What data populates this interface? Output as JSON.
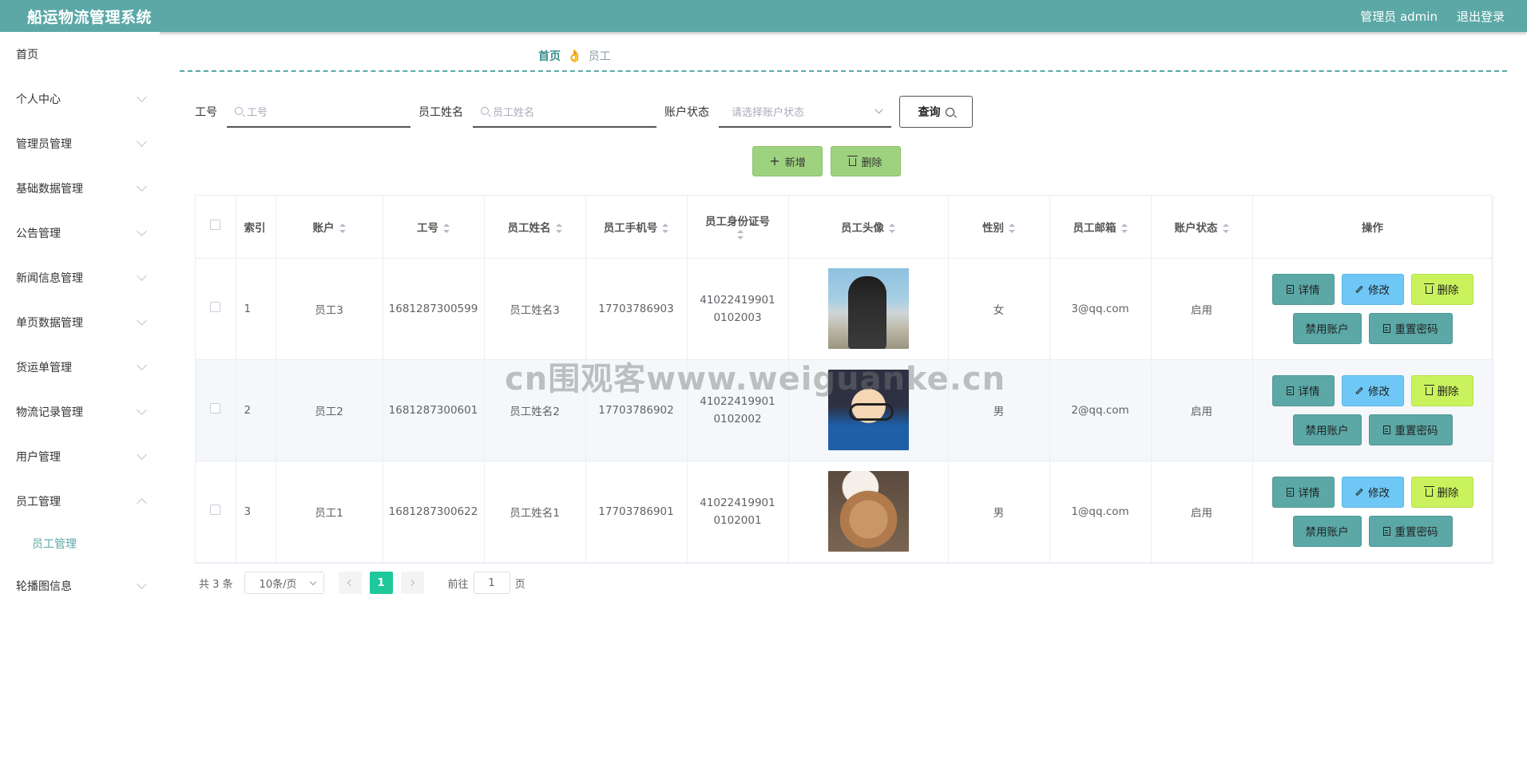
{
  "header": {
    "title": "船运物流管理系统",
    "user": "管理员 admin",
    "logout": "退出登录"
  },
  "sidebar": {
    "items": [
      {
        "label": "首页"
      },
      {
        "label": "个人中心"
      },
      {
        "label": "管理员管理"
      },
      {
        "label": "基础数据管理"
      },
      {
        "label": "公告管理"
      },
      {
        "label": "新闻信息管理"
      },
      {
        "label": "单页数据管理"
      },
      {
        "label": "货运单管理"
      },
      {
        "label": "物流记录管理"
      },
      {
        "label": "用户管理"
      },
      {
        "label": "员工管理"
      },
      {
        "label": "轮播图信息"
      }
    ],
    "sub_active": "员工管理"
  },
  "breadcrumb": {
    "home": "首页",
    "sep": "👌",
    "current": "员工"
  },
  "search": {
    "field1_label": "工号",
    "field1_placeholder": "工号",
    "field2_label": "员工姓名",
    "field2_placeholder": "员工姓名",
    "field3_label": "账户状态",
    "field3_placeholder": "请选择账户状态",
    "query_label": "查询"
  },
  "actions": {
    "add": "新增",
    "delete": "删除"
  },
  "table": {
    "headers": [
      "索引",
      "账户",
      "工号",
      "员工姓名",
      "员工手机号",
      "员工身份证号",
      "员工头像",
      "性别",
      "员工邮箱",
      "账户状态",
      "操作"
    ],
    "rows": [
      {
        "index": "1",
        "account": "员工3",
        "no": "1681287300599",
        "name": "员工姓名3",
        "phone": "17703786903",
        "id_card": "410224199010102003",
        "gender": "女",
        "email": "3@qq.com",
        "status": "启用"
      },
      {
        "index": "2",
        "account": "员工2",
        "no": "1681287300601",
        "name": "员工姓名2",
        "phone": "17703786902",
        "id_card": "410224199010102002",
        "gender": "男",
        "email": "2@qq.com",
        "status": "启用"
      },
      {
        "index": "3",
        "account": "员工1",
        "no": "1681287300622",
        "name": "员工姓名1",
        "phone": "17703786901",
        "id_card": "410224199010102001",
        "gender": "男",
        "email": "1@qq.com",
        "status": "启用"
      }
    ],
    "ops": {
      "detail": "详情",
      "edit": "修改",
      "delete": "删除",
      "ban": "禁用账户",
      "reset": "重置密码"
    }
  },
  "pager": {
    "total": "共 3 条",
    "page_size": "10条/页",
    "current": "1",
    "goto_prefix": "前往",
    "goto_value": "1",
    "goto_suffix": "页"
  },
  "watermark": "cn围观客www.weiguanke.cn",
  "colors": {
    "header": "#5ba8a7",
    "add_btn": "#9ed27f",
    "detail_btn": "#5ba8a7",
    "edit_btn": "#6ec7f5",
    "delete_btn": "#c9f25c",
    "active_page": "#1fc89a"
  }
}
